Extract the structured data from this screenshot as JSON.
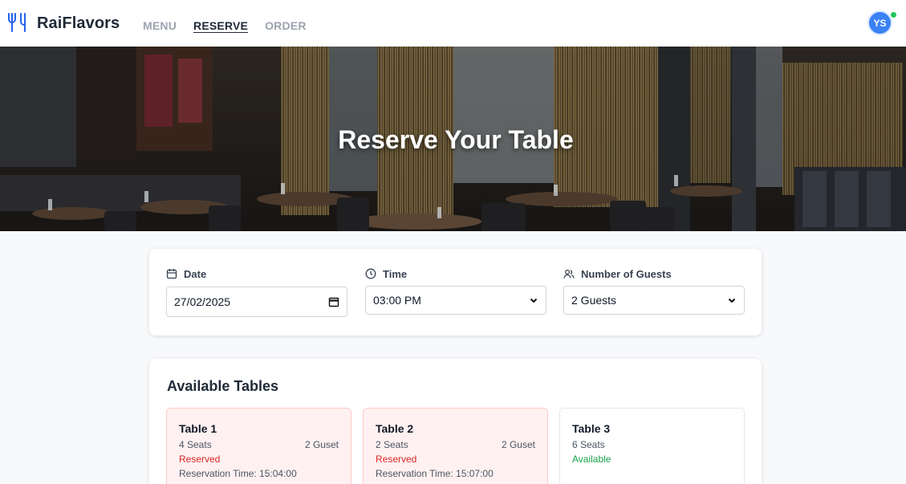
{
  "brand": {
    "name": "RaiFlavors",
    "logo_icon": "fork-knife-icon"
  },
  "nav": [
    {
      "label": "MENU",
      "active": false
    },
    {
      "label": "RESERVE",
      "active": true
    },
    {
      "label": "ORDER",
      "active": false
    }
  ],
  "user": {
    "initials": "YS",
    "online": true
  },
  "hero": {
    "title": "Reserve Your Table"
  },
  "filters": {
    "date": {
      "label": "Date",
      "icon": "calendar-icon",
      "value": "27/02/2025"
    },
    "time": {
      "label": "Time",
      "icon": "clock-icon",
      "value": "03:00 PM"
    },
    "guests": {
      "label": "Number of Guests",
      "icon": "users-icon",
      "value": "2 Guests"
    }
  },
  "tables_section": {
    "title": "Available Tables",
    "tables": [
      {
        "name": "Table 1",
        "seats": "4 Seats",
        "guests": "2 Guset",
        "status": "Reserved",
        "reservation": "Reservation Time: 15:04:00"
      },
      {
        "name": "Table 2",
        "seats": "2 Seats",
        "guests": "2 Guset",
        "status": "Reserved",
        "reservation": "Reservation Time: 15:07:00"
      },
      {
        "name": "Table 3",
        "seats": "6 Seats",
        "guests": "",
        "status": "Available",
        "reservation": ""
      }
    ]
  },
  "colors": {
    "accent": "#3b82f6",
    "reserved": "#dc2626",
    "available": "#16a34a"
  }
}
